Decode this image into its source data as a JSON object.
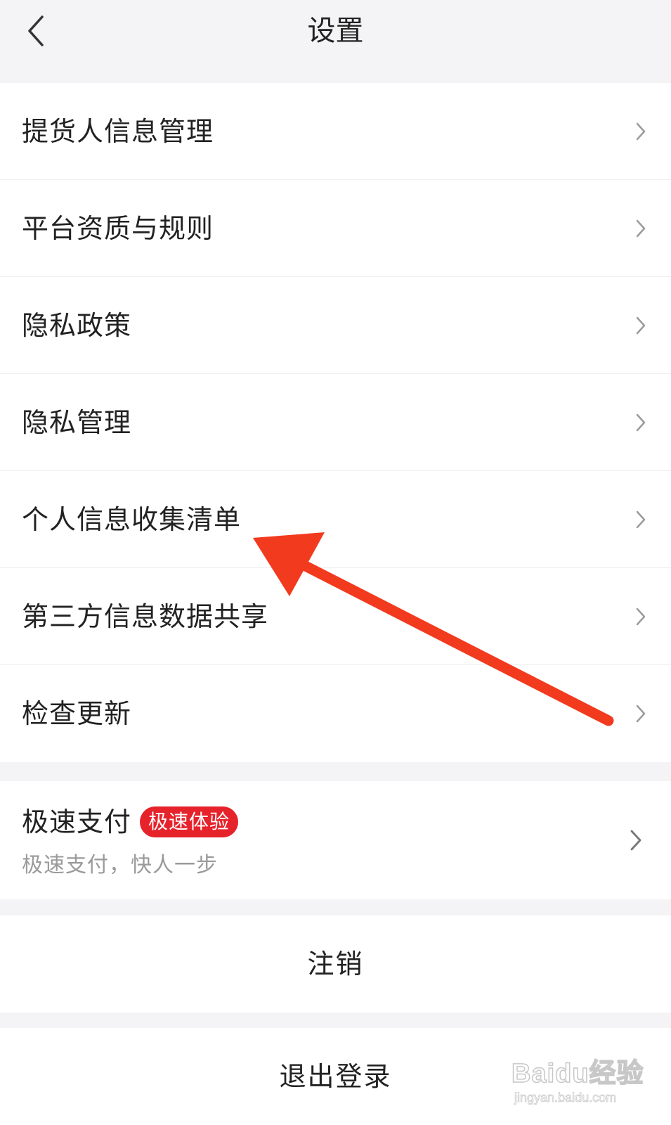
{
  "header": {
    "title": "设置",
    "back_icon": "chevron-left-icon"
  },
  "menu": {
    "items": [
      {
        "label": "提货人信息管理"
      },
      {
        "label": "平台资质与规则"
      },
      {
        "label": "隐私政策"
      },
      {
        "label": "隐私管理"
      },
      {
        "label": "个人信息收集清单"
      },
      {
        "label": "第三方信息数据共享"
      },
      {
        "label": "检查更新"
      }
    ],
    "chevron_icon": "chevron-right-icon"
  },
  "fast_pay": {
    "title": "极速支付",
    "badge": "极速体验",
    "subtitle": "极速支付，快人一步",
    "badge_color": "#e6222b"
  },
  "actions": {
    "cancel_label": "注销",
    "logout_label": "退出登录"
  },
  "annotation": {
    "color": "#f23a1e"
  },
  "watermark": {
    "logo": "Baidu经验",
    "url": "jingyan.baidu.com"
  }
}
